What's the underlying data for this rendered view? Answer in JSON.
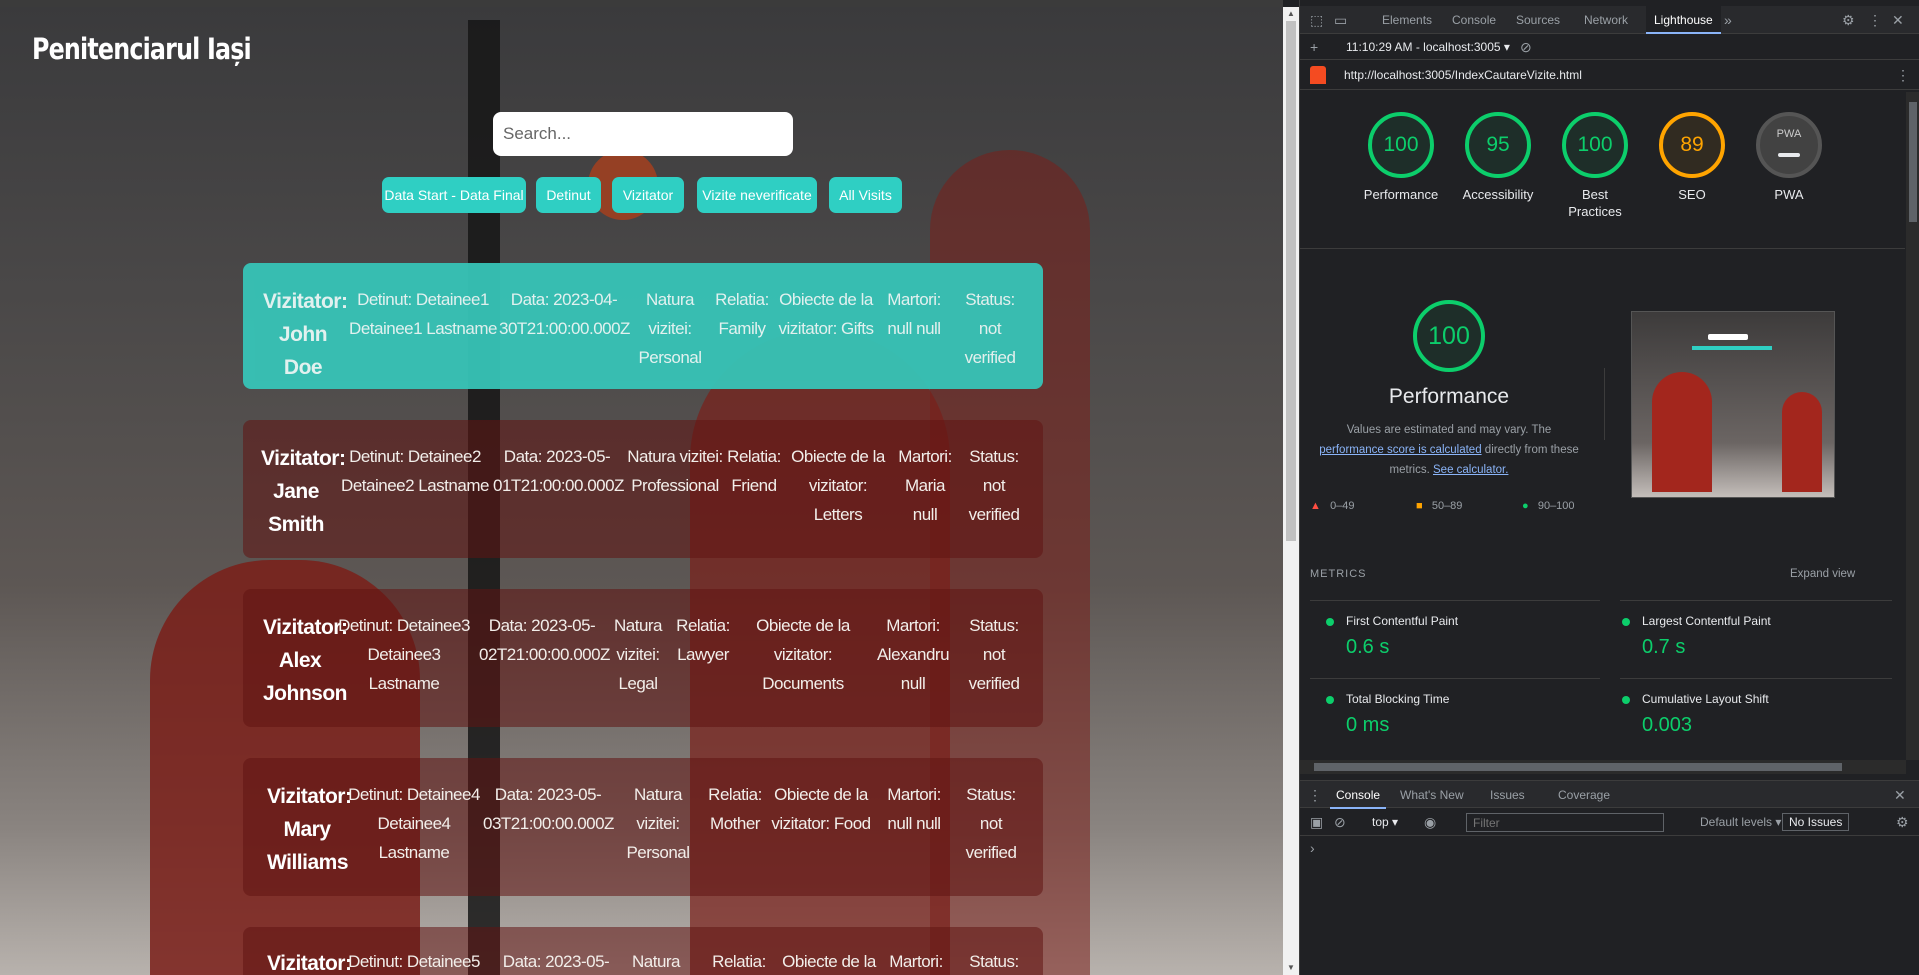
{
  "site": {
    "title": "Penitenciarul Iași",
    "search_placeholder": "Search...",
    "filters": [
      "Data Start - Data Final",
      "Detinut",
      "Vizitator",
      "Vizite neverificate",
      "All Visits"
    ]
  },
  "visits": [
    {
      "vizitator": "Vizitator: John Doe",
      "detinut": "Detinut: Detainee1 Detainee1 Lastname",
      "data": "Data: 2023-04-30T21:00:00.000Z",
      "natura": "Natura vizitei: Personal",
      "relatia": "Relatia: Family",
      "obiecte": "Obiecte de la vizitator: Gifts",
      "martori": "Martori: null null",
      "status": "Status: not verified"
    },
    {
      "vizitator": "Vizitator: Jane Smith",
      "detinut": "Detinut: Detainee2 Detainee2 Lastname",
      "data": "Data: 2023-05-01T21:00:00.000Z",
      "natura": "Natura vizitei: Professional",
      "relatia": "Relatia: Friend",
      "obiecte": "Obiecte de la vizitator: Letters",
      "martori": "Martori: Maria null",
      "status": "Status: not verified"
    },
    {
      "vizitator": "Vizitator: Alex Johnson",
      "detinut": "Detinut: Detainee3 Detainee3 Lastname",
      "data": "Data: 2023-05-02T21:00:00.000Z",
      "natura": "Natura vizitei: Legal",
      "relatia": "Relatia: Lawyer",
      "obiecte": "Obiecte de la vizitator: Documents",
      "martori": "Martori: Alexandru null",
      "status": "Status: not verified"
    },
    {
      "vizitator": "Vizitator: Mary Williams",
      "detinut": "Detinut: Detainee4 Detainee4 Lastname",
      "data": "Data: 2023-05-03T21:00:00.000Z",
      "natura": "Natura vizitei: Personal",
      "relatia": "Relatia: Mother",
      "obiecte": "Obiecte de la vizitator: Food",
      "martori": "Martori: null null",
      "status": "Status: not verified"
    },
    {
      "vizitator": "Vizitator:",
      "detinut": "Detinut: Detainee5",
      "data": "Data: 2023-05-",
      "natura": "Natura",
      "relatia": "Relatia:",
      "obiecte": "Obiecte de la",
      "martori": "Martori:",
      "status": "Status:"
    }
  ],
  "devtools": {
    "tabs": [
      "Elements",
      "Console",
      "Sources",
      "Network",
      "Lighthouse"
    ],
    "active_tab": "Lighthouse",
    "report_time": "11:10:29 AM - localhost:3005",
    "url": "http://localhost:3005/IndexCautareVizite.html",
    "scores": [
      {
        "value": "100",
        "label": "Performance",
        "color": "#0cce6b"
      },
      {
        "value": "95",
        "label": "Accessibility",
        "color": "#0cce6b"
      },
      {
        "value": "100",
        "label": "Best Practices",
        "color": "#0cce6b"
      },
      {
        "value": "89",
        "label": "SEO",
        "color": "#ffa400"
      },
      {
        "value": "PWA",
        "label": "PWA",
        "color": "#9aa0a6"
      }
    ],
    "perf_score": "100",
    "perf_title": "Performance",
    "perf_note_1": "Values are estimated and may vary. The",
    "perf_note_link1": "performance score is calculated",
    "perf_note_2": "directly from these metrics.",
    "perf_note_link2": "See calculator.",
    "legend": [
      "0–49",
      "50–89",
      "90–100"
    ],
    "metrics_label": "METRICS",
    "expand_view": "Expand view",
    "metrics": [
      {
        "name": "First Contentful Paint",
        "value": "0.6 s"
      },
      {
        "name": "Largest Contentful Paint",
        "value": "0.7 s"
      },
      {
        "name": "Total Blocking Time",
        "value": "0 ms"
      },
      {
        "name": "Cumulative Layout Shift",
        "value": "0.003"
      }
    ],
    "drawer_tabs": [
      "Console",
      "What's New",
      "Issues",
      "Coverage"
    ],
    "context": "top",
    "filter_placeholder": "Filter",
    "levels": "Default levels",
    "issues": "No Issues",
    "prompt": "›"
  }
}
